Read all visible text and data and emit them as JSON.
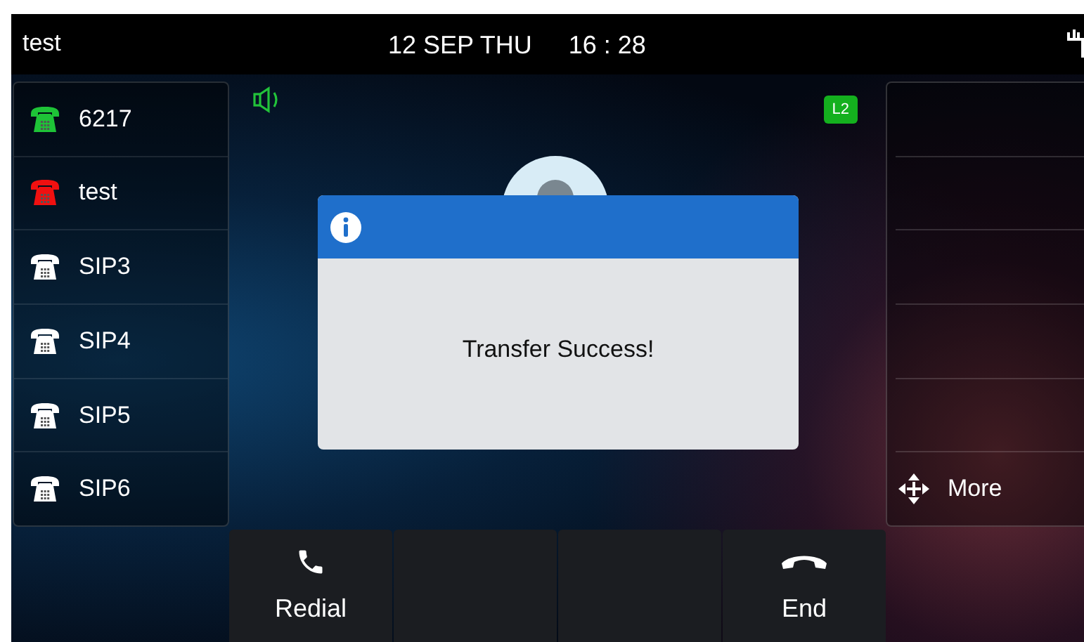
{
  "status_bar": {
    "account": "test",
    "date": "12 SEP THU",
    "time": "16 : 28"
  },
  "lines": [
    {
      "label": "6217",
      "color": "#1ec337"
    },
    {
      "label": "test",
      "color": "#f01010"
    },
    {
      "label": "SIP3",
      "color": "#ffffff"
    },
    {
      "label": "SIP4",
      "color": "#ffffff"
    },
    {
      "label": "SIP5",
      "color": "#ffffff"
    },
    {
      "label": "SIP6",
      "color": "#ffffff"
    }
  ],
  "call": {
    "line_badge": "L2"
  },
  "dialog": {
    "message": "Transfer Success!"
  },
  "function_keys": [
    {
      "kind": "blank"
    },
    {
      "kind": "blank"
    },
    {
      "kind": "blank"
    },
    {
      "kind": "blank"
    },
    {
      "kind": "blank"
    },
    {
      "kind": "more",
      "label": "More"
    }
  ],
  "softkeys": [
    {
      "kind": "redial",
      "label": "Redial"
    },
    {
      "kind": "blank"
    },
    {
      "kind": "blank"
    },
    {
      "kind": "end",
      "label": "End"
    }
  ]
}
